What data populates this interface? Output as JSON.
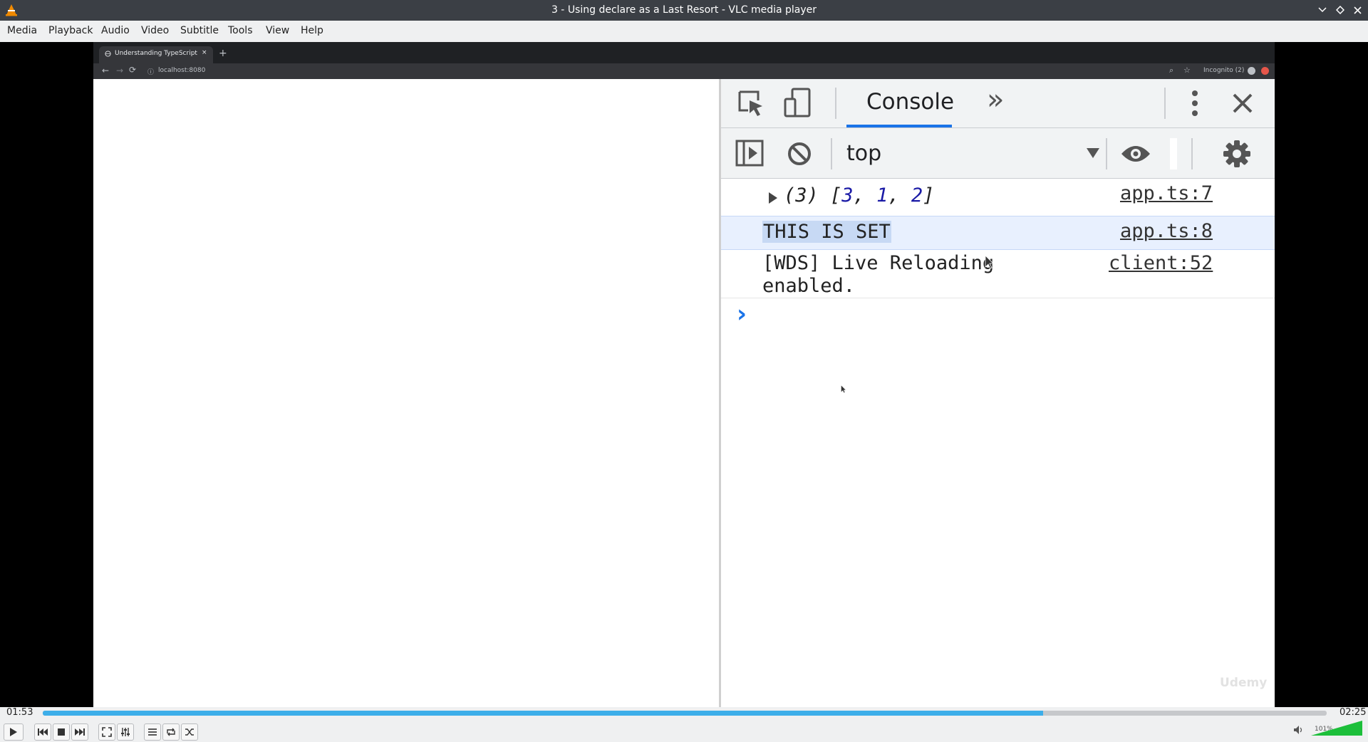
{
  "window": {
    "title": "3 - Using declare as a Last Resort - VLC media player"
  },
  "menu": [
    "Media",
    "Playback",
    "Audio",
    "Video",
    "Subtitle",
    "Tools",
    "View",
    "Help"
  ],
  "browser": {
    "tab_title": "Understanding TypeScript",
    "tab_close": "×",
    "new_tab": "+",
    "url": "localhost:8080",
    "profile": "Incognito (2)"
  },
  "devtools": {
    "active_tab": "Console",
    "more_tabs": "»",
    "context": "top",
    "logs": [
      {
        "prefix": "(3) [",
        "values": [
          "3",
          "1",
          "2"
        ],
        "suffix": "]",
        "source": "app.ts:7"
      },
      {
        "text": "THIS IS SET",
        "source": "app.ts:8"
      },
      {
        "line1": "[WDS] Live Reloading",
        "line2": "enabled.",
        "source": "client:52"
      }
    ],
    "prompt": "›",
    "watermark": "Udemy"
  },
  "player": {
    "time_current": "01:53",
    "time_total": "02:25",
    "progress": 0.779,
    "volume_label": "101%",
    "volume": 1.01
  },
  "colors": {
    "accent": "#3daee9",
    "console_blue": "#1a73e8"
  }
}
